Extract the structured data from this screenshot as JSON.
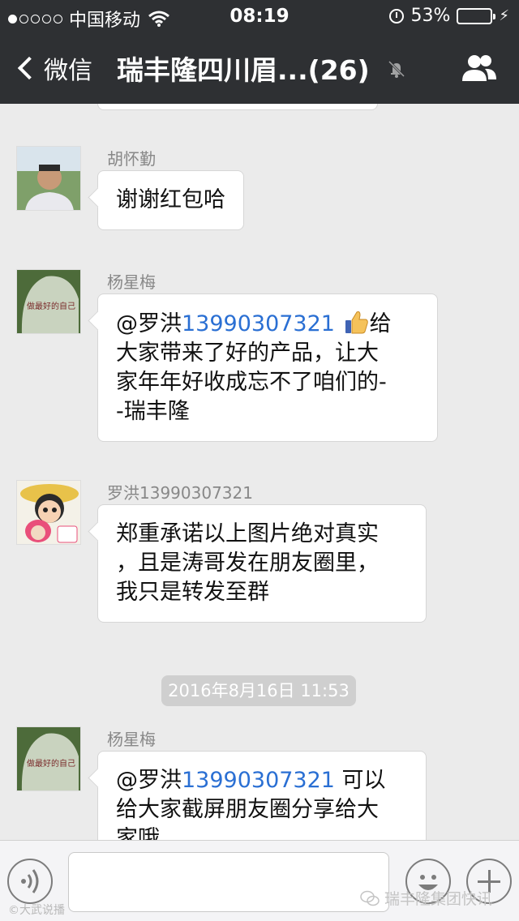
{
  "status": {
    "carrier": "中国移动",
    "time": "08:19",
    "battery": "53%",
    "battery_level": 0.53,
    "signal_bars": 1
  },
  "nav": {
    "back_label": "微信",
    "title": "瑞丰隆四川眉...(26)",
    "icons": {
      "back": "chevron-left-icon",
      "mute": "bell-muted-icon",
      "members": "people-icon"
    }
  },
  "messages": [
    {
      "sender": "胡怀勤",
      "lines": [
        "谢谢红包哈"
      ]
    },
    {
      "sender": "杨星梅",
      "mention": "@罗洪",
      "mention_number": "13990307321",
      "lines_after": [
        "给",
        "大家带来了好的产品，让大",
        "家年年好收成忘不了咱们的-",
        "-瑞丰隆"
      ]
    },
    {
      "sender": "罗洪13990307321",
      "lines": [
        "郑重承诺以上图片绝对真实",
        "，且是涛哥发在朋友圈里，",
        "我只是转发至群"
      ]
    },
    {
      "sender": "杨星梅",
      "mention": "@罗洪",
      "mention_number": "13990307321",
      "lines_after": [
        " 可以",
        "给大家截屏朋友圈分享给大",
        "家哦"
      ]
    }
  ],
  "timestamp": "2016年8月16日 11:53",
  "avatar_text": "做最好的自己",
  "bottom": {
    "icons": {
      "voice": "voice-icon",
      "emoji": "emoji-icon",
      "more": "plus-icon"
    }
  },
  "watermark_left": "©大武说播",
  "watermark_right": "瑞丰隆集团快讯"
}
